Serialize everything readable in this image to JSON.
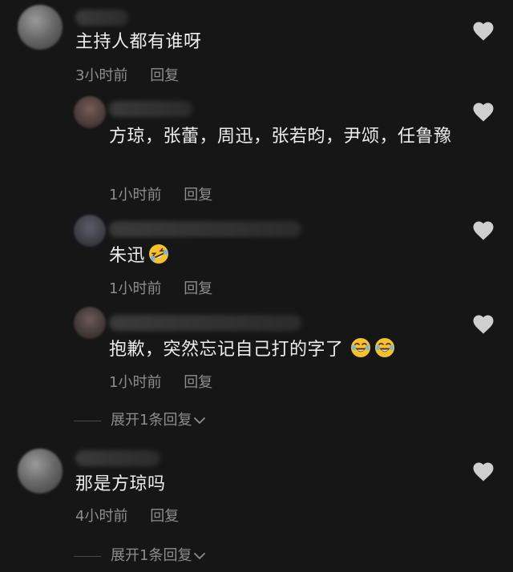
{
  "comments": [
    {
      "text": "主持人都有谁呀",
      "time": "3小时前",
      "reply": "回复"
    },
    {
      "text": "方琼，张蕾，周迅，张若昀，尹颂，任鲁豫",
      "time": "1小时前",
      "reply": "回复"
    },
    {
      "text": "朱迅",
      "time": "1小时前",
      "reply": "回复",
      "emoji": "rolling-laughing-emoji"
    },
    {
      "text": "抱歉，突然忘记自己打的字了",
      "time": "1小时前",
      "reply": "回复",
      "emoji": "crying-laughing-emoji"
    },
    {
      "text": "那是方琼吗",
      "time": "4小时前",
      "reply": "回复"
    }
  ],
  "expand_replies": [
    {
      "label": "展开1条回复"
    },
    {
      "label": "展开1条回复"
    }
  ],
  "icons": {
    "like": "heart-icon",
    "expand": "chevron-down-icon"
  },
  "colors": {
    "background": "#161616",
    "text": "#ededed",
    "meta": "#8d8d8d",
    "heart": "#cfcfcf"
  }
}
